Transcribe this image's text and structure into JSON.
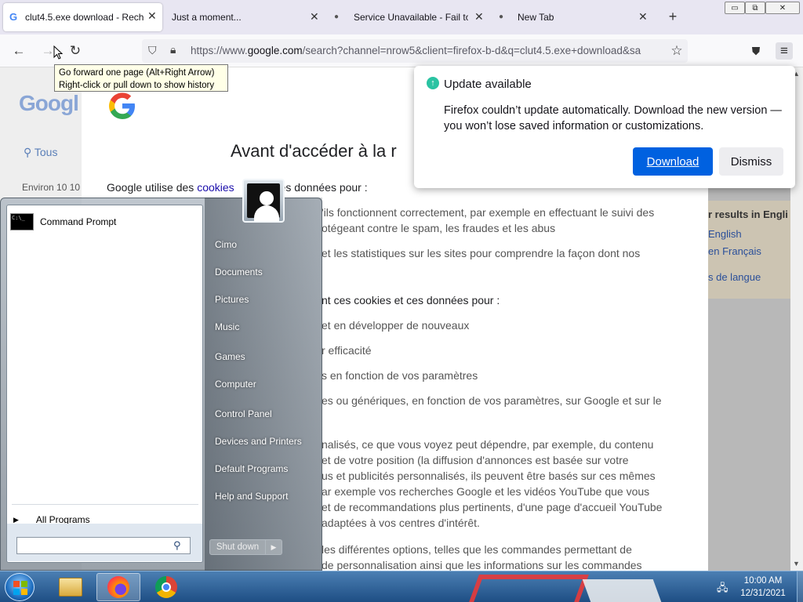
{
  "browser": {
    "tabs": [
      {
        "title": "clut4.5.exe download - Recherche",
        "active": true
      },
      {
        "title": "Just a moment...",
        "active": false
      },
      {
        "title": "Service Unavailable - Fail to c",
        "active": false
      },
      {
        "title": "New Tab",
        "active": false
      }
    ],
    "new_tab": "+",
    "window_controls": {
      "minimize": "▭",
      "restore": "⧉",
      "close": "✕"
    },
    "url": {
      "prefix": "https://www.",
      "domain": "google.com",
      "rest": "/search?channel=nrow5&client=firefox-b-d&q=clut4.5.exe+download&sa"
    },
    "tooltip": {
      "line1": "Go forward one page (Alt+Right Arrow)",
      "line2": "Right-click or pull down to show history"
    }
  },
  "update_panel": {
    "title": "Update available",
    "message": "Firefox couldn’t update automatically. Download the new version — you won’t lose saved information or customizations.",
    "download_label": "Download",
    "dismiss_label": "Dismiss"
  },
  "google_bg": {
    "logo": "Googl",
    "tab_all": "Tous",
    "results_count": "Environ 10 10",
    "right_panel": {
      "line1": "r results in Engli",
      "line2": "English",
      "line3": "en Français",
      "line4": "s de langue"
    }
  },
  "consent": {
    "title": "Avant d'accéder à la r",
    "intro_before": "Google utilise des ",
    "intro_link": "cookies",
    "intro_after": " es données pour :",
    "lines": [
      "'ils fonctionnent correctement, par exemple en effectuant le suivi des",
      "otégeant contre le spam, les fraudes et les abus",
      "et les statistiques sur les sites pour comprendre la façon dont nos",
      "nt ces cookies et ces données pour :",
      "et en développer de nouveaux",
      "r efficacité",
      "s en fonction de vos paramètres",
      "es ou génériques, en fonction de vos paramètres, sur Google et sur le",
      "nalisés, ce que vous voyez peut dépendre, par exemple, du contenu",
      "et de votre position (la diffusion d'annonces est basée sur votre",
      "us et publicités personnalisés, ils peuvent être basés sur ces mêmes",
      "ar exemple vos recherches Google et les vidéos YouTube que vous",
      "et de recommandations plus pertinents, d'une page d'accueil YouTube",
      "adaptées à vos centres d'intérêt.",
      "les différentes options, telles que les commandes permettant de",
      "de personnalisation ainsi que les informations sur les commandes"
    ]
  },
  "start_menu": {
    "pinned": [
      {
        "label": "Command Prompt"
      }
    ],
    "all_programs": "All Programs",
    "search_placeholder": "",
    "right_items": [
      "Cimo",
      "Documents",
      "Pictures",
      "Music",
      "Games",
      "Computer",
      "Control Panel",
      "Devices and Printers",
      "Default Programs",
      "Help and Support"
    ],
    "shutdown_label": "Shut down"
  },
  "taskbar": {
    "clock_time": "10:00 AM",
    "clock_date": "12/31/2021",
    "apps": [
      "file-explorer",
      "firefox",
      "chrome"
    ]
  },
  "colors": {
    "firefox_accent": "#0061e0",
    "update_icon": "#2ac3a2",
    "taskbar": "#1e4e84"
  }
}
